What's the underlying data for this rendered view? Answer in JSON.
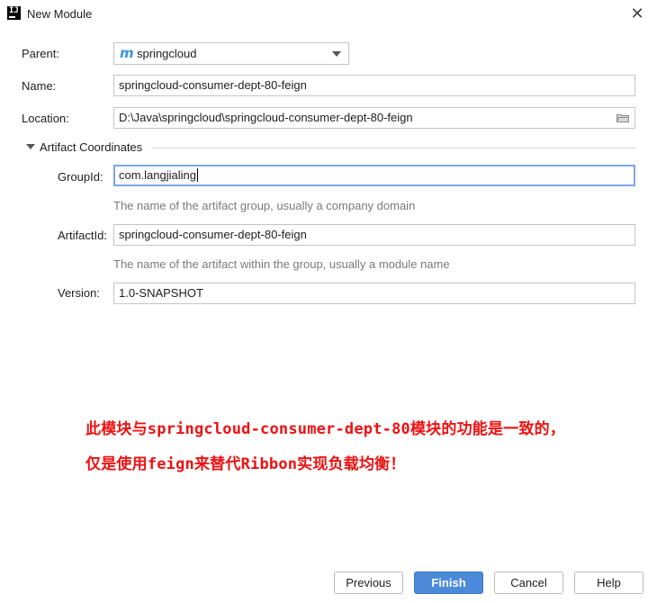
{
  "window": {
    "app_icon_text": "IJ",
    "title": "New Module",
    "close_glyph": "✕"
  },
  "form": {
    "parent": {
      "label": "Parent:",
      "icon": "m",
      "value": "springcloud"
    },
    "name": {
      "label": "Name:",
      "value": "springcloud-consumer-dept-80-feign"
    },
    "location": {
      "label": "Location:",
      "value": "D:\\Java\\springcloud\\springcloud-consumer-dept-80-feign"
    }
  },
  "artifact": {
    "section_title": "Artifact Coordinates",
    "group_id": {
      "label": "GroupId:",
      "value": "com.langjialing",
      "hint": "The name of the artifact group, usually a company domain"
    },
    "artifact_id": {
      "label": "ArtifactId:",
      "value": "springcloud-consumer-dept-80-feign",
      "hint": "The name of the artifact within the group, usually a module name"
    },
    "version": {
      "label": "Version:",
      "value": "1.0-SNAPSHOT"
    }
  },
  "annotation": {
    "line1": "此模块与springcloud-consumer-dept-80模块的功能是一致的，",
    "line2": "仅是使用feign来替代Ribbon实现负载均衡！",
    "color": "#ee1111"
  },
  "buttons": {
    "previous": "Previous",
    "finish": "Finish",
    "cancel": "Cancel",
    "help": "Help"
  },
  "colors": {
    "accent": "#4a8ad8",
    "focus_border": "#7aa7e6",
    "maven_icon": "#3c94d9"
  }
}
